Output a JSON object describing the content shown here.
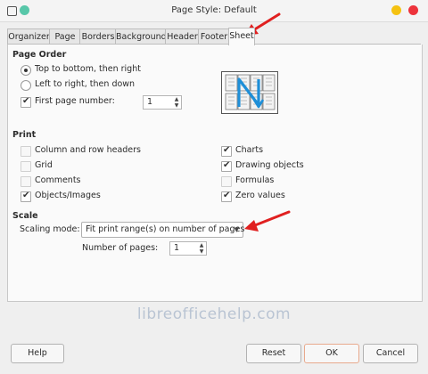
{
  "window": {
    "title": "Page Style: Default",
    "controls": {
      "minimize_color": "#f5c211",
      "close_color": "#ed333b",
      "left_dot_color": "#57c7a9"
    }
  },
  "tabs": [
    "Organizer",
    "Page",
    "Borders",
    "Background",
    "Header",
    "Footer",
    "Sheet"
  ],
  "active_tab": "Sheet",
  "page_order": {
    "heading": "Page Order",
    "options": [
      {
        "label": "Top to bottom, then right",
        "selected": true
      },
      {
        "label": "Left to right, then down",
        "selected": false
      }
    ],
    "first_page_number": {
      "label": "First page number:",
      "checked": true,
      "value": "1"
    }
  },
  "print": {
    "heading": "Print",
    "left": [
      {
        "label": "Column and row headers",
        "checked": false
      },
      {
        "label": "Grid",
        "checked": false
      },
      {
        "label": "Comments",
        "checked": false
      },
      {
        "label": "Objects/Images",
        "checked": true
      }
    ],
    "right": [
      {
        "label": "Charts",
        "checked": true
      },
      {
        "label": "Drawing objects",
        "checked": true
      },
      {
        "label": "Formulas",
        "checked": false
      },
      {
        "label": "Zero values",
        "checked": true
      }
    ]
  },
  "scale": {
    "heading": "Scale",
    "mode_label": "Scaling mode:",
    "mode_value": "Fit print range(s) on number of pages",
    "pages_label": "Number of pages:",
    "pages_value": "1"
  },
  "watermark": "libreofficehelp.com",
  "buttons": {
    "help": "Help",
    "reset": "Reset",
    "ok": "OK",
    "cancel": "Cancel"
  },
  "colors": {
    "annotation_arrow": "#e02020",
    "preview_arrow": "#1e8fd8",
    "watermark": "#b9c4d3"
  }
}
